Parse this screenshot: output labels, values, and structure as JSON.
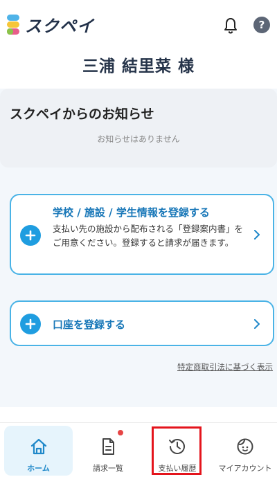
{
  "app": {
    "logo_text": "スクペイ",
    "help_label": "?",
    "user_name": "三浦 結里菜 様"
  },
  "notices": {
    "title": "スクペイからのお知らせ",
    "empty_text": "お知らせはありません"
  },
  "actions": {
    "register_school": {
      "title": "学校 / 施設 / 学生情報を登録する",
      "description": "支払い先の施設から配布される「登録案内書」をご用意ください。登録すると請求が届きます。"
    },
    "register_account": {
      "title": "口座を登録する"
    }
  },
  "law_link": "特定商取引法に基づく表示",
  "bottom_nav": {
    "home": "ホーム",
    "invoices": "請求一覧",
    "history": "支払い履歴",
    "account": "マイアカウント"
  },
  "colors": {
    "accent": "#1f9de0",
    "card_border": "#4ab3e6",
    "title_blue": "#1877b8",
    "highlight": "#e4141c",
    "badge": "#e64545"
  }
}
